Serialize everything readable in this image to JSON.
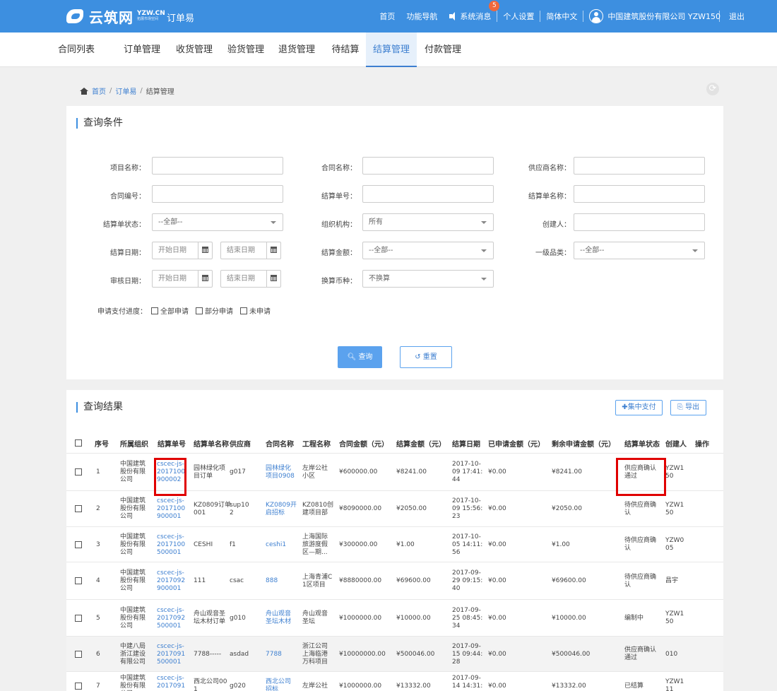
{
  "header": {
    "logo_text": "云筑网",
    "logo_sub1": "YZW.CN",
    "logo_sub2": "拓展市场空间",
    "app_name": "订单易",
    "nav": [
      "首页",
      "功能导航",
      "系统消息",
      "个人设置",
      "简体中文"
    ],
    "message_badge": "5",
    "user": "中国建筑股份有限公司 YZW150",
    "logout": "退出"
  },
  "tabs": [
    "合同列表",
    "订单管理",
    "收货管理",
    "验货管理",
    "退货管理",
    "待结算",
    "结算管理",
    "付款管理"
  ],
  "active_tab": "结算管理",
  "breadcrumb": [
    "首页",
    "订单易",
    "结算管理"
  ],
  "query": {
    "title": "查询条件",
    "labels": {
      "project_name": "项目名称：",
      "contract_name": "合同名称：",
      "supplier_name": "供应商名称：",
      "contract_no": "合同编号：",
      "settle_no": "结算单号：",
      "settle_name": "结算单名称：",
      "settle_status": "结算单状态：",
      "org": "组织机构：",
      "creator": "创建人：",
      "settle_date": "结算日期：",
      "settle_amount": "结算金额：",
      "category": "一级品类：",
      "audit_date": "审核日期：",
      "currency": "换算币种："
    },
    "values": {
      "settle_status": "--全部--",
      "org": "所有",
      "settle_amount": "--全部--",
      "category": "--全部--",
      "currency": "不换算"
    },
    "placeholders": {
      "start_date": "开始日期",
      "end_date": "结束日期"
    },
    "progress_label": "申请支付进度：",
    "progress_options": [
      "全部申请",
      "部分申请",
      "未申请"
    ],
    "query_button": "查询",
    "reset_button": "重置"
  },
  "results": {
    "title": "查询结果",
    "batch_pay": "集中支付",
    "export": "导出",
    "columns": [
      "序号",
      "所属组织",
      "结算单号",
      "结算单名称",
      "供应商",
      "合同名称",
      "工程名称",
      "合同金额（元）",
      "结算金额（元）",
      "结算日期",
      "已申请金额（元）",
      "剩余申请金额（元）",
      "结算单状态",
      "创建人",
      "操作"
    ],
    "rows": [
      {
        "no": "1",
        "org": [
          "中国建筑",
          "股份有限",
          "公司"
        ],
        "settle_no": [
          "cscec-js-",
          "2017100",
          "900002"
        ],
        "settle_name": [
          "园林绿化项",
          "目订单"
        ],
        "supplier": [
          "g017"
        ],
        "contract": [
          "园林绿化",
          "项目0908"
        ],
        "project": [
          "左岸公社",
          "小区"
        ],
        "contract_amt": "¥600000.00",
        "settle_amt": "¥8241.00",
        "date": [
          "2017-10-",
          "09 17:41:",
          "44"
        ],
        "applied": "¥0.00",
        "remain": "¥8241.00",
        "status": [
          "供应商确认",
          "通过"
        ],
        "creator": [
          "YZW1",
          "50"
        ]
      },
      {
        "no": "2",
        "org": [
          "中国建筑",
          "股份有限",
          "公司"
        ],
        "settle_no": [
          "cscec-js-",
          "2017100",
          "900001"
        ],
        "settle_name": [
          "KZ0809订单",
          "001"
        ],
        "supplier": [
          "sup10",
          "2"
        ],
        "contract": [
          "KZ0809开",
          "启招标"
        ],
        "project": [
          "KZ0810创",
          "建项目部"
        ],
        "contract_amt": "¥8090000.00",
        "settle_amt": "¥2050.00",
        "date": [
          "2017-10-",
          "09 15:56:",
          "23"
        ],
        "applied": "¥0.00",
        "remain": "¥2050.00",
        "status": [
          "待供应商确",
          "认"
        ],
        "creator": [
          "YZW1",
          "50"
        ]
      },
      {
        "no": "3",
        "org": [
          "中国建筑",
          "股份有限",
          "公司"
        ],
        "settle_no": [
          "cscec-js-",
          "2017100",
          "500001"
        ],
        "settle_name": [
          "CESHI"
        ],
        "supplier": [
          "f1"
        ],
        "contract": [
          "ceshi1"
        ],
        "project": [
          "上海国际",
          "旅游度假",
          "区—期..."
        ],
        "contract_amt": "¥300000.00",
        "settle_amt": "¥1.00",
        "date": [
          "2017-10-",
          "05 14:11:",
          "56"
        ],
        "applied": "¥0.00",
        "remain": "¥1.00",
        "status": [
          "待供应商确",
          "认"
        ],
        "creator": [
          "YZW0",
          "05"
        ]
      },
      {
        "no": "4",
        "org": [
          "中国建筑",
          "股份有限",
          "公司"
        ],
        "settle_no": [
          "cscec-js-",
          "2017092",
          "900001"
        ],
        "settle_name": [
          "111"
        ],
        "supplier": [
          "csac"
        ],
        "contract": [
          "888"
        ],
        "project": [
          "上海青浦C",
          "1区项目"
        ],
        "contract_amt": "¥8880000.00",
        "settle_amt": "¥69600.00",
        "date": [
          "2017-09-",
          "29 09:15:",
          "40"
        ],
        "applied": "¥0.00",
        "remain": "¥69600.00",
        "status": [
          "待供应商确",
          "认"
        ],
        "creator": [
          "昌宇"
        ]
      },
      {
        "no": "5",
        "org": [
          "中国建筑",
          "股份有限",
          "公司"
        ],
        "settle_no": [
          "cscec-js-",
          "2017092",
          "500001"
        ],
        "settle_name": [
          "舟山观音圣",
          "坛木材订单"
        ],
        "supplier": [
          "g010"
        ],
        "contract": [
          "舟山观音",
          "圣坛木材"
        ],
        "project": [
          "舟山观音",
          "圣坛"
        ],
        "contract_amt": "¥1000000.00",
        "settle_amt": "¥10000.00",
        "date": [
          "2017-09-",
          "25 08:45:",
          "34"
        ],
        "applied": "¥0.00",
        "remain": "¥10000.00",
        "status": [
          "编制中"
        ],
        "creator": [
          "YZW1",
          "50"
        ]
      },
      {
        "no": "6",
        "org": [
          "中建八局",
          "浙江建设",
          "有限公司"
        ],
        "settle_no": [
          "cscec-js-",
          "2017091",
          "500001"
        ],
        "settle_name": [
          "7788-----"
        ],
        "supplier": [
          "asdad"
        ],
        "contract": [
          "7788"
        ],
        "project": [
          "浙江公司",
          "上海临港",
          "万科项目"
        ],
        "contract_amt": "¥10000000.00",
        "settle_amt": "¥500046.00",
        "date": [
          "2017-09-",
          "15 09:44:",
          "28"
        ],
        "applied": "¥0.00",
        "remain": "¥500046.00",
        "status": [
          "供应商确认",
          "通过"
        ],
        "creator": [
          "010"
        ]
      },
      {
        "no": "7",
        "org": [
          "中国建筑",
          "股份有限",
          "公司"
        ],
        "settle_no": [
          "cscec-js-",
          "2017091",
          "..."
        ],
        "settle_name": [
          "西北公司00",
          "1"
        ],
        "supplier": [
          "g020"
        ],
        "contract": [
          "西北公司",
          "招标"
        ],
        "project": [
          "左岸公社"
        ],
        "contract_amt": "¥1000000.00",
        "settle_amt": "¥13332.00",
        "date": [
          "2017-09-",
          "14 14:31:",
          "..."
        ],
        "applied": "¥0.00",
        "remain": "¥13332.00",
        "status": [
          "已结算"
        ],
        "creator": [
          "YZW1",
          "11"
        ]
      }
    ]
  }
}
